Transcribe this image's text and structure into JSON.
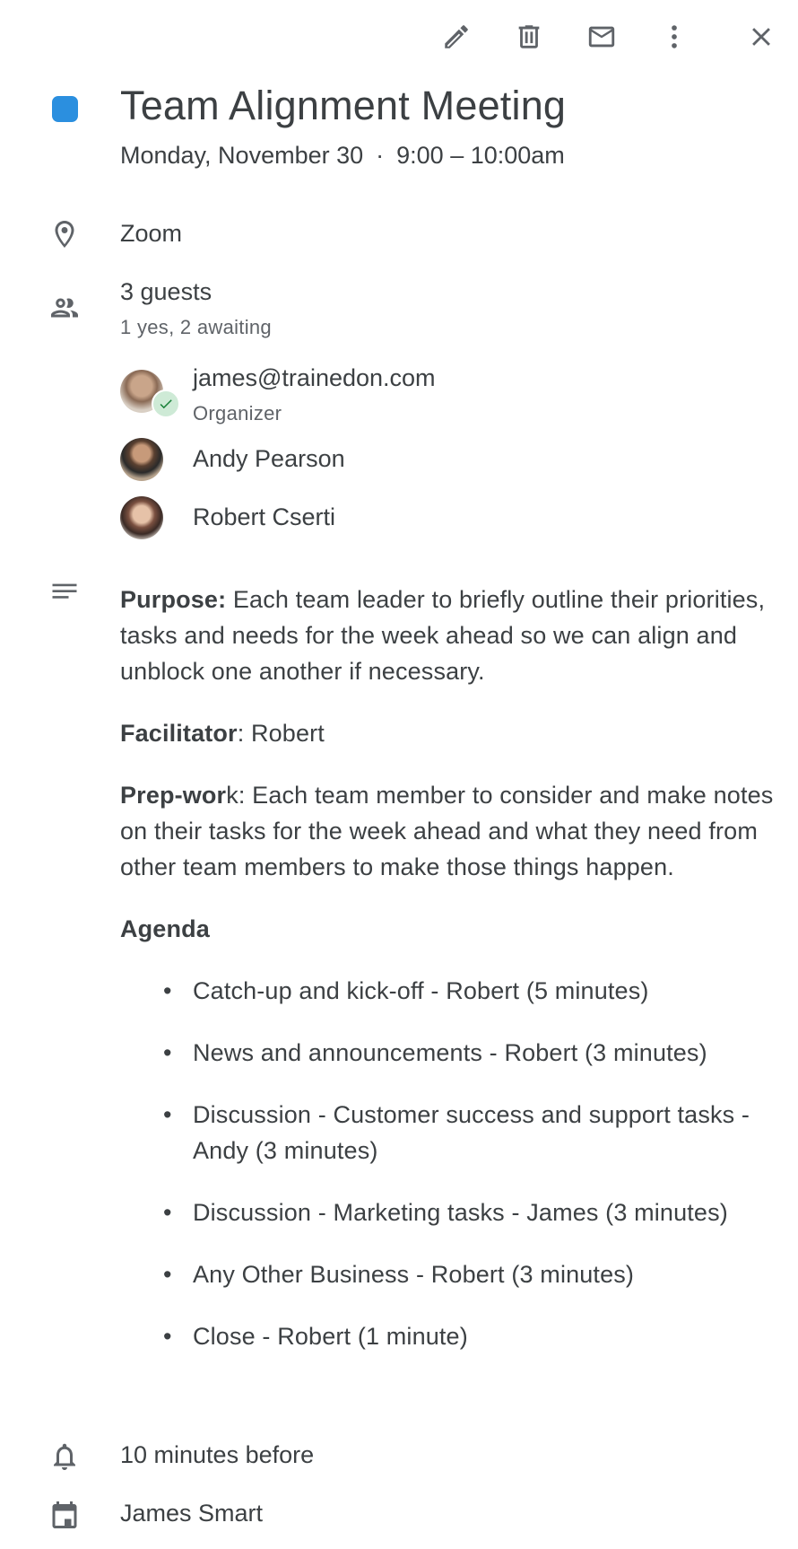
{
  "toolbar": {
    "edit_icon": "pencil-icon",
    "delete_icon": "trash-icon",
    "email_icon": "mail-icon",
    "more_icon": "more-vert-icon",
    "close_icon": "close-icon"
  },
  "event": {
    "color": "#2b8fdf",
    "title": "Team Alignment Meeting",
    "date": "Monday, November 30",
    "separator": "·",
    "time": "9:00 – 10:00am",
    "location": "Zoom",
    "guests_summary": "3 guests",
    "guests_status": "1 yes, 2 awaiting",
    "guests": [
      {
        "name": "james@trainedon.com",
        "role": "Organizer",
        "accepted": true
      },
      {
        "name": "Andy Pearson"
      },
      {
        "name": "Robert Cserti"
      }
    ],
    "description": {
      "purpose_label": "Purpose:",
      "purpose_text": " Each team leader to briefly outline their priorities, tasks and needs for the week ahead so we can align and unblock one another if necessary.",
      "facilitator_label": "Facilitator",
      "facilitator_text": ": Robert",
      "prep_label": "Prep-wor",
      "prep_text": "k: Each team member to consider and make notes on their tasks for the week ahead and what they need from other team members to make those things happen.",
      "agenda_label": "Agenda",
      "agenda": [
        "Catch-up and kick-off - Robert (5 minutes)",
        "News and announcements - Robert (3 minutes)",
        "Discussion - Customer success and support tasks - Andy (3 minutes)",
        "Discussion - Marketing tasks - James (3 minutes)",
        "Any Other Business - Robert (3 minutes)",
        "Close - Robert (1 minute)"
      ]
    },
    "reminder": "10 minutes before",
    "calendar_owner": "James Smart"
  }
}
